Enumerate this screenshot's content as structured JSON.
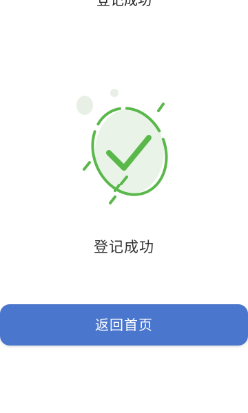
{
  "header": {
    "title": "登记成功"
  },
  "result": {
    "message": "登记成功",
    "icon": "success-check-icon"
  },
  "actions": {
    "home_label": "返回首页"
  },
  "colors": {
    "accent": "#4a76cd",
    "success": "#5ab84b",
    "success_fill": "#e8f3e6",
    "bubble": "#e8f0e6"
  }
}
